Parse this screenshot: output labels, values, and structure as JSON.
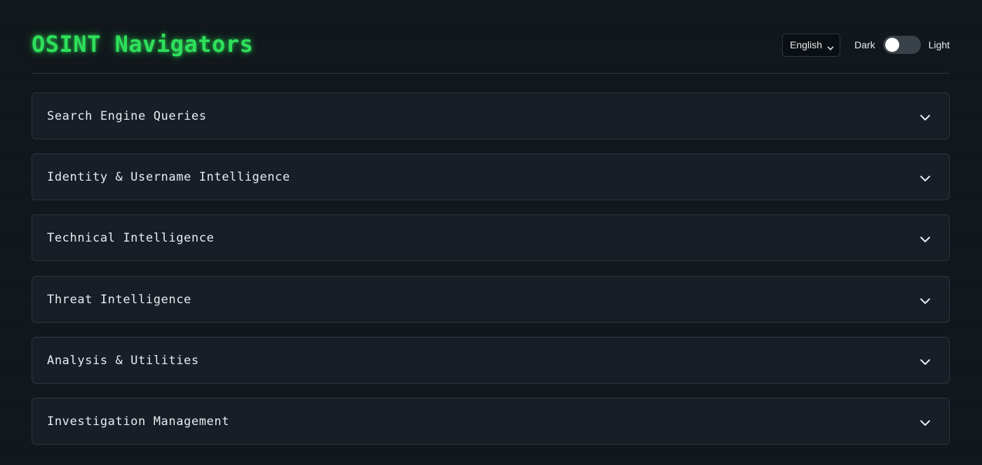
{
  "app": {
    "title": "OSINT Navigators"
  },
  "header": {
    "language": {
      "selected": "English",
      "icon": "chevron-down-icon"
    },
    "theme_toggle": {
      "left_label": "Dark",
      "right_label": "Light",
      "state": "Dark"
    }
  },
  "sections": [
    {
      "label": "Search Engine Queries",
      "icon": "chevron-down-icon"
    },
    {
      "label": "Identity & Username Intelligence",
      "icon": "chevron-down-icon"
    },
    {
      "label": "Technical Intelligence",
      "icon": "chevron-down-icon"
    },
    {
      "label": "Threat Intelligence",
      "icon": "chevron-down-icon"
    },
    {
      "label": "Analysis & Utilities",
      "icon": "chevron-down-icon"
    },
    {
      "label": "Investigation Management",
      "icon": "chevron-down-icon"
    }
  ],
  "colors": {
    "accent": "#2ee05a",
    "background": "#0f151a",
    "panel": "#151c23",
    "border": "#2c353e",
    "text": "#e6edf3"
  }
}
